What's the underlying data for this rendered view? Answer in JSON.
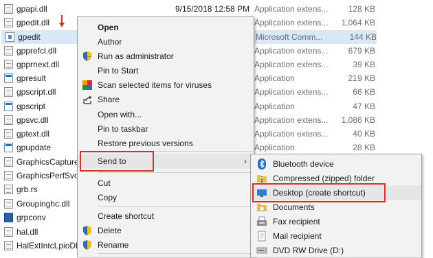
{
  "files": [
    {
      "name": "gpapi.dll",
      "date": "9/15/2018 12:58 PM",
      "type": "Application extens...",
      "size": "128 KB",
      "icon": "dll-file-icon"
    },
    {
      "name": "gpedit.dll",
      "date": "",
      "type": "Application extens...",
      "size": "1,064 KB",
      "icon": "dll-file-icon"
    },
    {
      "name": "gpedit",
      "date": "",
      "type": "Microsoft Comm...",
      "size": "144 KB",
      "icon": "msc-file-icon"
    },
    {
      "name": "gpprefcl.dll",
      "date": "",
      "type": "Application extens...",
      "size": "679 KB",
      "icon": "dll-file-icon"
    },
    {
      "name": "gpprnext.dll",
      "date": "",
      "type": "Application extens...",
      "size": "39 KB",
      "icon": "dll-file-icon"
    },
    {
      "name": "gpresult",
      "date": "",
      "type": "Application",
      "size": "219 KB",
      "icon": "exe-file-icon"
    },
    {
      "name": "gpscript.dll",
      "date": "",
      "type": "Application extens...",
      "size": "66 KB",
      "icon": "dll-file-icon"
    },
    {
      "name": "gpscript",
      "date": "",
      "type": "Application",
      "size": "47 KB",
      "icon": "exe-file-icon"
    },
    {
      "name": "gpsvc.dll",
      "date": "",
      "type": "Application extens...",
      "size": "1,086 KB",
      "icon": "dll-file-icon"
    },
    {
      "name": "gptext.dll",
      "date": "",
      "type": "Application extens...",
      "size": "40 KB",
      "icon": "dll-file-icon"
    },
    {
      "name": "gpupdate",
      "date": "",
      "type": "Application",
      "size": "28 KB",
      "icon": "exe-file-icon"
    },
    {
      "name": "GraphicsCapture",
      "date": "",
      "type": "",
      "size": "",
      "icon": "dll-file-icon"
    },
    {
      "name": "GraphicsPerfSvc.",
      "date": "",
      "type": "",
      "size": "",
      "icon": "dll-file-icon"
    },
    {
      "name": "grb.rs",
      "date": "",
      "type": "",
      "size": "",
      "icon": "dll-file-icon"
    },
    {
      "name": "Groupinghc.dll",
      "date": "",
      "type": "",
      "size": "",
      "icon": "dll-file-icon"
    },
    {
      "name": "grpconv",
      "date": "",
      "type": "",
      "size": "",
      "icon": "grpconv-icon"
    },
    {
      "name": "hal.dll",
      "date": "",
      "type": "",
      "size": "",
      "icon": "dll-file-icon"
    },
    {
      "name": "HalExtIntcLpioDM",
      "date": "",
      "type": "",
      "size": "",
      "icon": "dll-file-icon"
    }
  ],
  "context_menu": {
    "items": [
      {
        "label": "Open",
        "icon": "",
        "bold": true
      },
      {
        "label": "Author",
        "icon": ""
      },
      {
        "label": "Run as administrator",
        "icon": "uac-shield-icon"
      },
      {
        "label": "Pin to Start",
        "icon": ""
      },
      {
        "label": "Scan selected items for viruses",
        "icon": "antivirus-icon"
      },
      {
        "label": "Share",
        "icon": "share-icon"
      },
      {
        "label": "Open with...",
        "icon": ""
      },
      {
        "label": "Pin to taskbar",
        "icon": ""
      },
      {
        "label": "Restore previous versions",
        "icon": ""
      },
      {
        "label": "Send to",
        "icon": "",
        "submenu": true
      },
      {
        "label": "Cut",
        "icon": ""
      },
      {
        "label": "Copy",
        "icon": ""
      },
      {
        "label": "Create shortcut",
        "icon": ""
      },
      {
        "label": "Delete",
        "icon": "uac-shield-icon"
      },
      {
        "label": "Rename",
        "icon": "uac-shield-icon"
      }
    ]
  },
  "send_to_menu": {
    "items": [
      {
        "label": "Bluetooth device",
        "icon": "bluetooth-icon"
      },
      {
        "label": "Compressed (zipped) folder",
        "icon": "zip-folder-icon"
      },
      {
        "label": "Desktop (create shortcut)",
        "icon": "desktop-icon"
      },
      {
        "label": "Documents",
        "icon": "documents-icon"
      },
      {
        "label": "Fax recipient",
        "icon": "fax-icon"
      },
      {
        "label": "Mail recipient",
        "icon": "mail-icon"
      },
      {
        "label": "DVD RW Drive (D:)",
        "icon": "dvd-drive-icon"
      }
    ]
  },
  "colors": {
    "highlight_red": "#d32f2f",
    "selection_blue": "#d9e8f7",
    "menu_bg": "#f2f2f2"
  }
}
